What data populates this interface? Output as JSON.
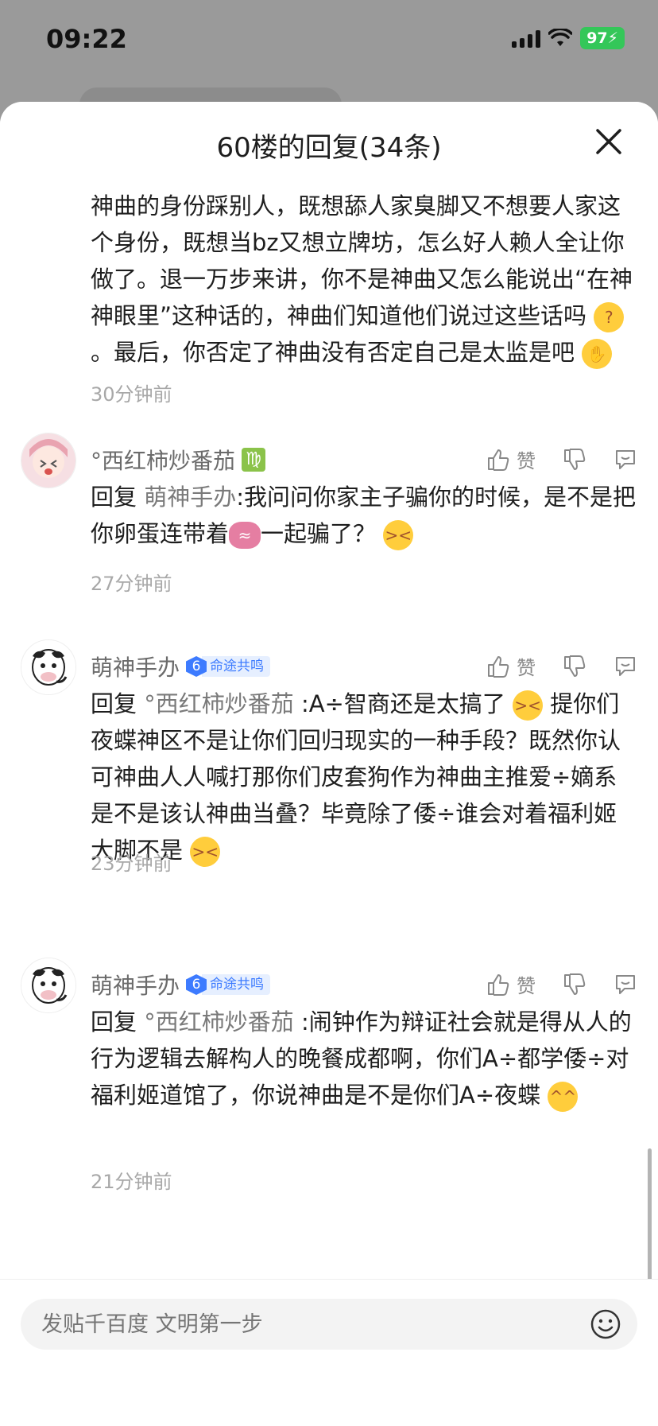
{
  "status_bar": {
    "time": "09:22",
    "battery": "97",
    "accent": "#34c759"
  },
  "sheet": {
    "title": "60楼的回复(34条)"
  },
  "comments": [
    {
      "partial": true,
      "text_parts": [
        "神曲的身份踩别人，既想舔人家臭脚又不想要人家这个身份，既想当bz又想立牌坊，怎么好人赖人全让你做了。退一万步来讲，你不是神曲又怎么能说出“在神神眼里”这种话的，神曲们知道他们说过这些话吗 ",
        " 。最后，你否定了神曲没有否定自己是太监是吧 "
      ],
      "time": "30分钟前"
    },
    {
      "username": "°西红柿炒番茄",
      "zodiac": "♍",
      "reply_kw": "回复 ",
      "reply_to": "萌神手办",
      "text_parts": [
        ":我问问你家主子骗你的时候，是不是把你卵蛋连带着",
        "一起骗了？ "
      ],
      "time": "27分钟前",
      "like_label": "赞"
    },
    {
      "username": "萌神手办",
      "level": "6",
      "badge": "命途共鸣",
      "reply_kw": "回复 ",
      "reply_to": "°西红柿炒番茄",
      "text_parts": [
        " :A÷智商还是太搞了 ",
        " 提你们夜蝶神区不是让你们回归现实的一种手段？既然你认可神曲人人喊打那你们皮套狗作为神曲主推爱÷嫡系是不是该认神曲当叠？毕竟除了倭÷谁会对着福利姬大脚不是 "
      ],
      "time": "23分钟前",
      "like_label": "赞"
    },
    {
      "username": "萌神手办",
      "level": "6",
      "badge": "命途共鸣",
      "reply_kw": "回复 ",
      "reply_to": "°西红柿炒番茄",
      "text_parts": [
        " :闹钟作为辩证社会就是得从人的行为逻辑去解构人的晚餐成都啊，你们A÷都学倭÷对福利姬道馆了，你说神曲是不是你们A÷夜蝶 "
      ],
      "time": "21分钟前",
      "like_label": "赞"
    }
  ],
  "input": {
    "placeholder": "发贴千百度 文明第一步"
  },
  "icons": [
    "close-icon",
    "thumb-up-icon",
    "thumb-down-icon",
    "comment-icon",
    "emoji-icon"
  ]
}
